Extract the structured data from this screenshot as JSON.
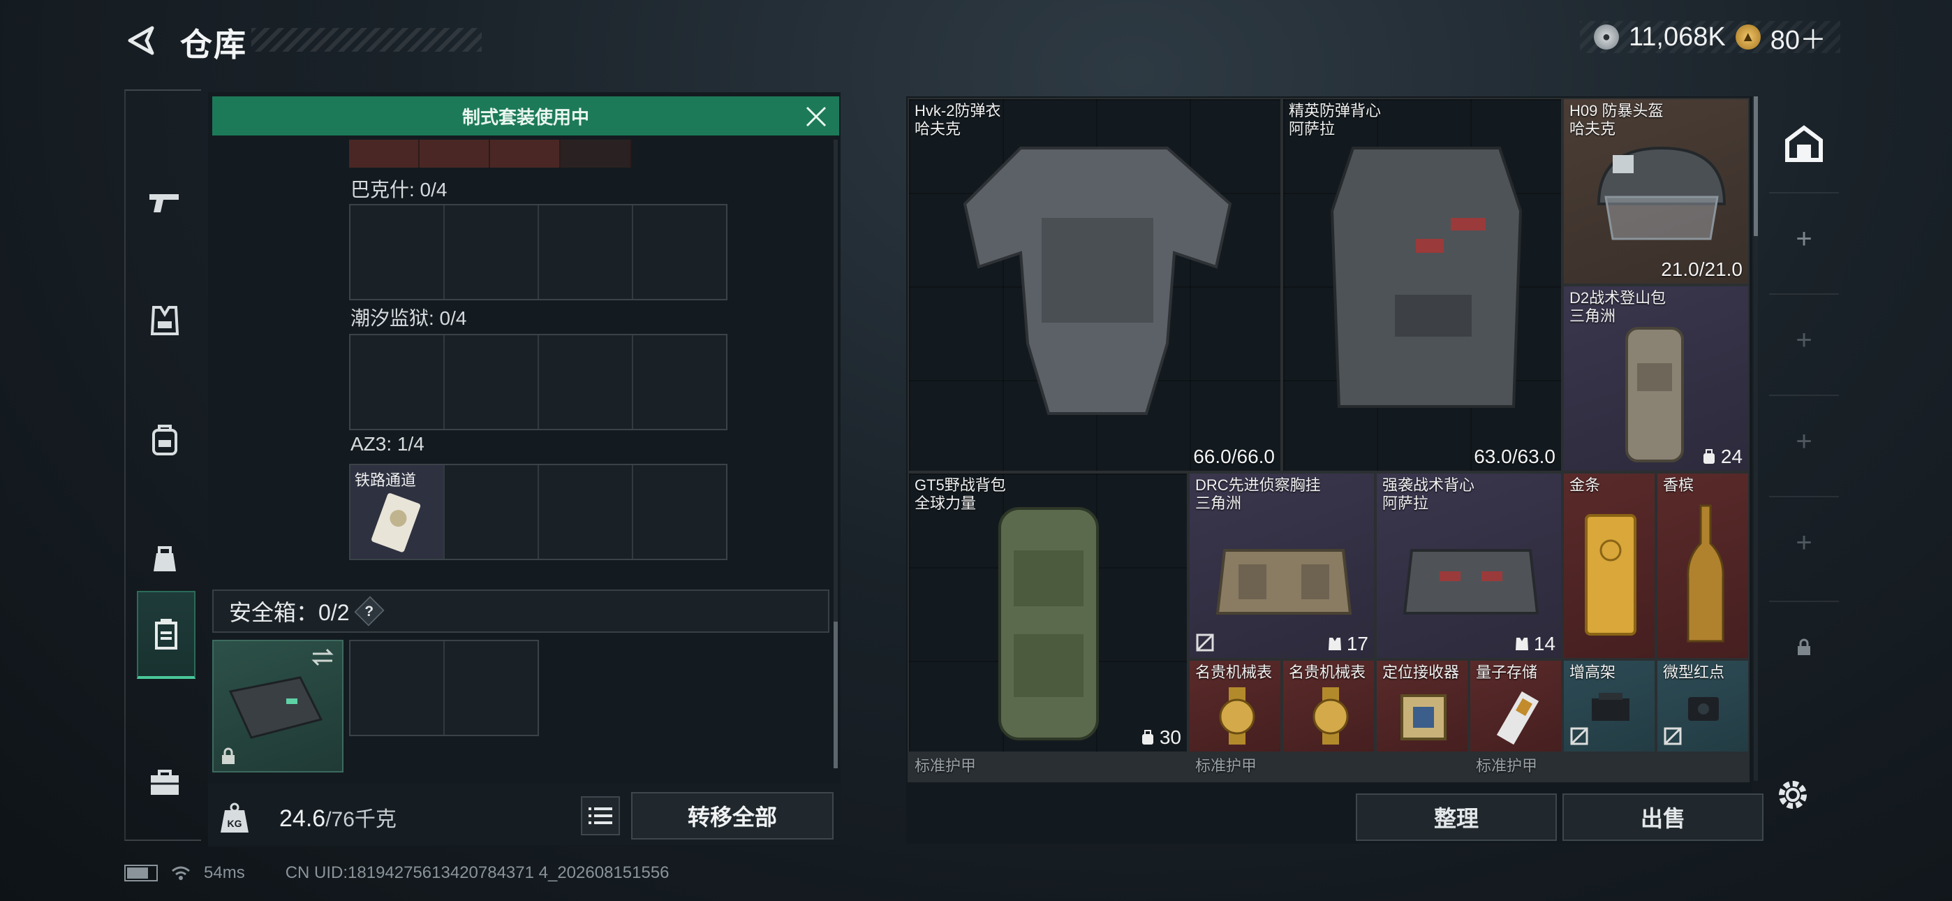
{
  "header": {
    "title": "仓库"
  },
  "currency": {
    "silver": "11,068K",
    "gold": "80＋"
  },
  "tabs": [
    "pistol-icon",
    "vest-icon",
    "backpack-icon",
    "pouch-icon",
    "safe-box-icon",
    "briefcase-icon"
  ],
  "banner": {
    "text": "制式套装使用中"
  },
  "sections": [
    {
      "label": "巴克什: 0/4"
    },
    {
      "label": "潮汐监狱: 0/4"
    },
    {
      "label": "AZ3: 1/4",
      "item": "铁路通道"
    }
  ],
  "safe_box": {
    "label": "安全箱：0/2",
    "help": "?"
  },
  "capacity": {
    "weight": "24.6",
    "max": "/76千克"
  },
  "buttons": {
    "transfer_all": "转移全部",
    "sort": "整理",
    "sell": "出售"
  },
  "items": [
    {
      "name": "Hvk-2防弹衣",
      "sub": "哈夫克",
      "value": "66.0/66.0",
      "color": "brown"
    },
    {
      "name": "精英防弹背心",
      "sub": "阿萨拉",
      "value": "63.0/63.0",
      "color": "brown"
    },
    {
      "name": "H09 防暴头盔",
      "sub": "哈夫克",
      "value": "21.0/21.0",
      "color": "brown"
    },
    {
      "name": "D2战术登山包",
      "sub": "三角洲",
      "count": "24",
      "color": "purple"
    },
    {
      "name": "GT5野战背包",
      "sub": "全球力量",
      "count": "30",
      "color": "brown"
    },
    {
      "name": "DRC先进侦察胸挂",
      "sub": "三角洲",
      "count": "17",
      "color": "purple"
    },
    {
      "name": "强袭战术背心",
      "sub": "阿萨拉",
      "count": "14",
      "color": "purple"
    },
    {
      "name": "金条",
      "color": "red"
    },
    {
      "name": "香槟",
      "color": "red"
    },
    {
      "name": "名贵机械表",
      "color": "red"
    },
    {
      "name": "名贵机械表",
      "color": "red"
    },
    {
      "name": "定位接收器",
      "color": "red"
    },
    {
      "name": "量子存储",
      "color": "red"
    },
    {
      "name": "增高架",
      "color": "teal"
    },
    {
      "name": "微型红点",
      "color": "teal"
    },
    {
      "name": "标准护甲"
    },
    {
      "name": "标准护甲"
    },
    {
      "name": "标准护甲"
    }
  ],
  "status": {
    "ping": "54ms",
    "uid": "CN UID:18194275613420784371 4_202608151556"
  },
  "colors": {
    "accent_green": "#1d7a58",
    "brown": "#4a3d35",
    "purple": "#3a364d",
    "red": "#5a2a2a",
    "teal": "#2d4b55"
  }
}
